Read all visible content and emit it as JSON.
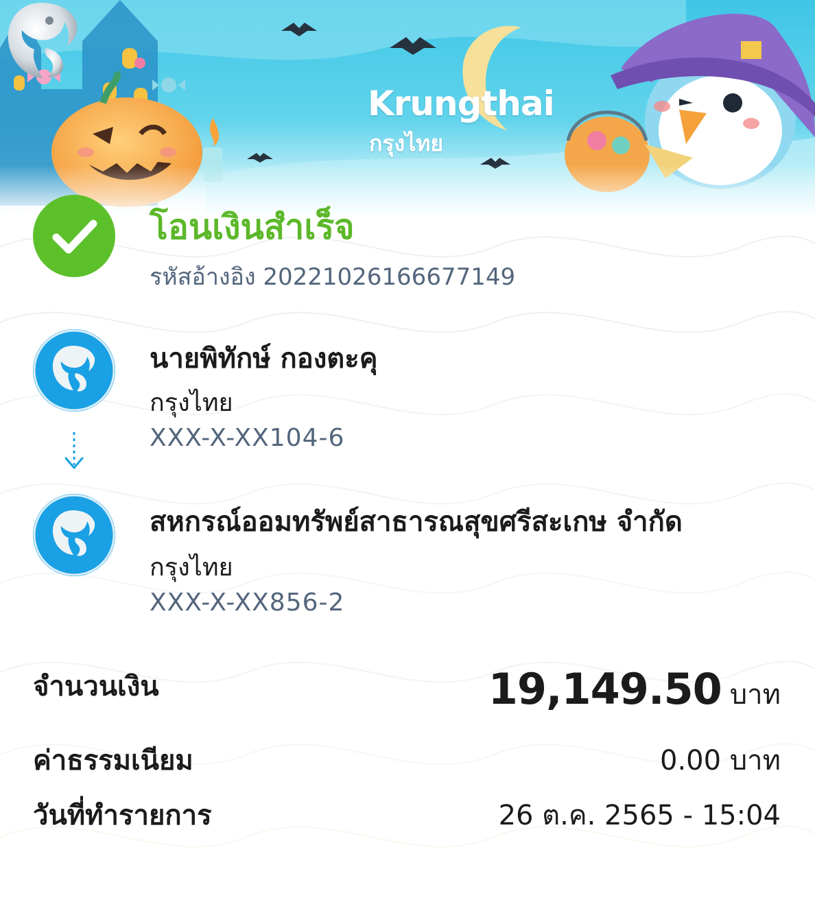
{
  "brand": {
    "name_en": "Krungthai",
    "name_th": "กรุงไทย"
  },
  "status": {
    "title": "โอนเงินสำเร็จ",
    "reference": "รหัสอ้างอิง 20221026166677149"
  },
  "sender": {
    "name": "นายพิทักษ์ กองตะคุ",
    "bank": "กรุงไทย",
    "account": "XXX-X-XX104-6"
  },
  "receiver": {
    "name": "สหกรณ์ออมทรัพย์สาธารณสุขศรีสะเกษ จำกัด",
    "bank": "กรุงไทย",
    "account": "XXX-X-XX856-2"
  },
  "summary": {
    "amount_label": "จำนวนเงิน",
    "amount_value": "19,149.50",
    "amount_unit": "บาท",
    "fee_label": "ค่าธรรมเนียม",
    "fee_value": "0.00 บาท",
    "date_label": "วันที่ทำรายการ",
    "date_value": "26 ต.ค. 2565 - 15:04"
  },
  "colors": {
    "success": "#5cc02a",
    "brand_blue": "#1aa0e4",
    "secondary_text": "#53657c"
  }
}
